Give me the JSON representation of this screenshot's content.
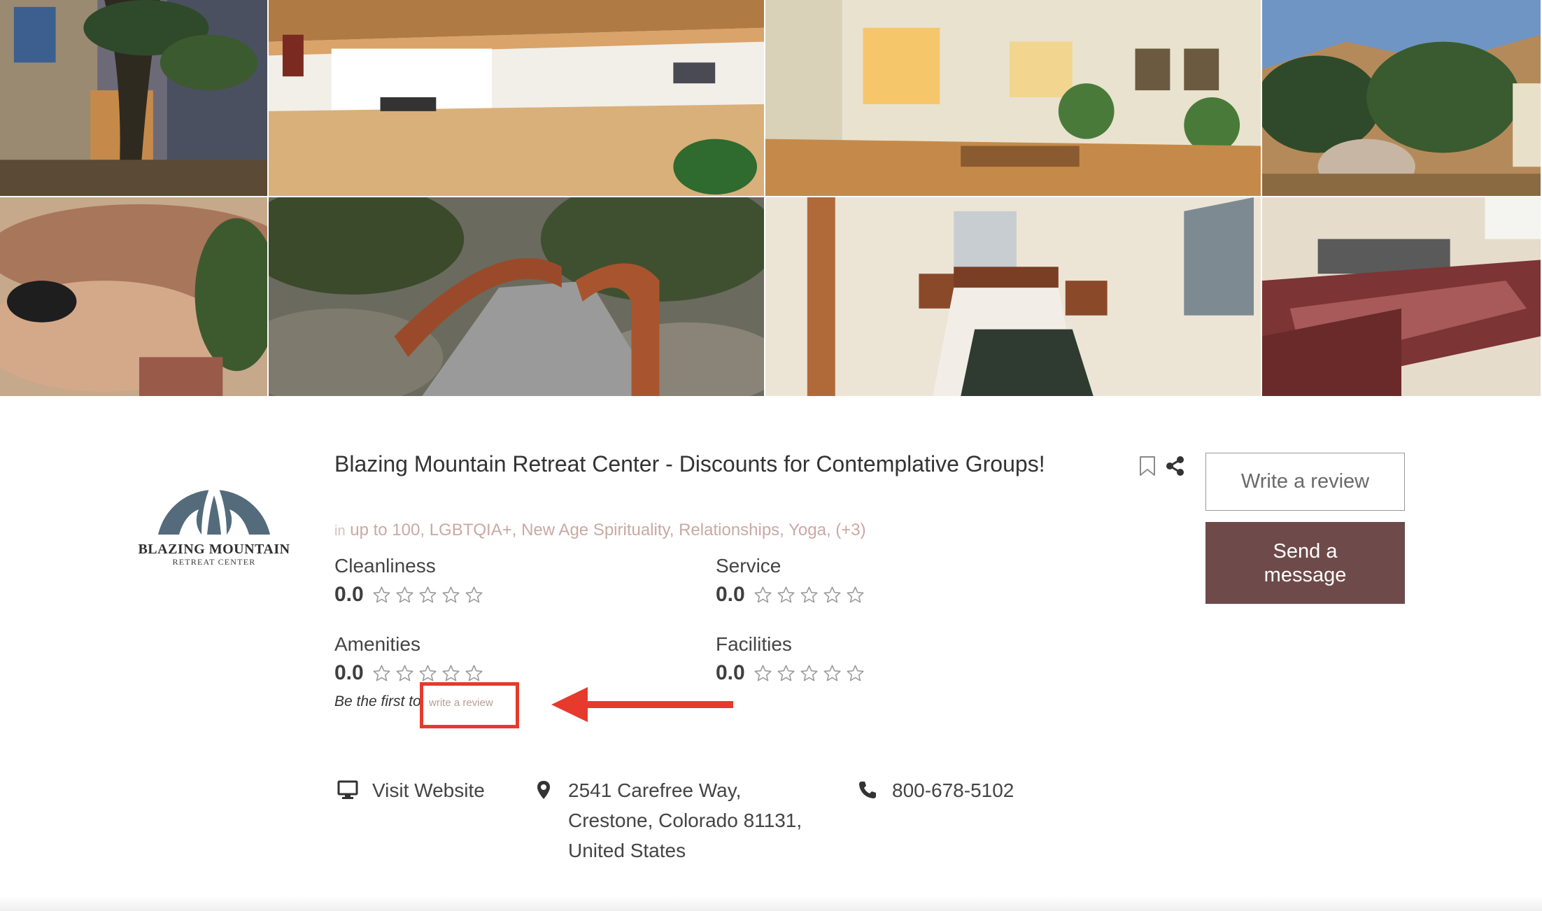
{
  "gallery": {
    "photos": [
      {
        "name": "stone-building",
        "alt": "Stone building with pine tree"
      },
      {
        "name": "meditation-hall",
        "alt": "Bright meditation hall"
      },
      {
        "name": "sunlit-room",
        "alt": "Sunlit room with plants"
      },
      {
        "name": "desert-trees",
        "alt": "Desert trees and boulder"
      },
      {
        "name": "stone-patio",
        "alt": "Curved stone patio"
      },
      {
        "name": "wooden-bridge",
        "alt": "Wooden bridge among pines"
      },
      {
        "name": "bedroom",
        "alt": "Bedroom with green blanket"
      },
      {
        "name": "meeting-tables",
        "alt": "Tables in meeting room"
      }
    ]
  },
  "logo": {
    "name": "BLAZING MOUNTAIN",
    "sub": "RETREAT CENTER",
    "color": "#546b7c"
  },
  "listing": {
    "title": "Blazing Mountain Retreat Center - Discounts for Contemplative Groups!",
    "in_prefix": "in",
    "categories": [
      "up to 100",
      "LGBTQIA+",
      "New Age Spirituality",
      "Relationships",
      "Yoga",
      "(+3)"
    ]
  },
  "actions": {
    "write_review": "Write a review",
    "send_message": "Send a message",
    "bookmark_icon": "bookmark-icon",
    "share_icon": "share-icon"
  },
  "ratings": [
    {
      "label": "Cleanliness",
      "score": "0.0",
      "stars": 0
    },
    {
      "label": "Service",
      "score": "0.0",
      "stars": 0
    },
    {
      "label": "Amenities",
      "score": "0.0",
      "stars": 0
    },
    {
      "label": "Facilities",
      "score": "0.0",
      "stars": 0
    }
  ],
  "first_review": {
    "text": "Be the first to",
    "link": "write a review"
  },
  "contact": {
    "website": "Visit Website",
    "address": [
      "2541 Carefree Way,",
      "Crestone, Colorado 81131,",
      "United States"
    ],
    "phone": "800-678-5102"
  },
  "colors": {
    "accent": "#6e4a4a",
    "category": "#c9a9a3",
    "annotation": "#e63a2d"
  }
}
